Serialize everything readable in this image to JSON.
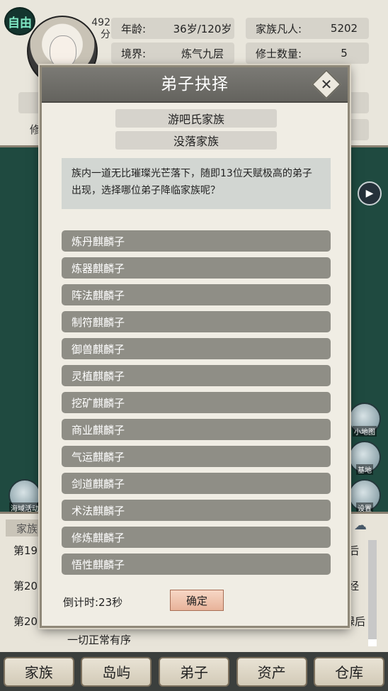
{
  "hud": {
    "free_badge": "自由",
    "score": "492分",
    "stats": [
      {
        "key": "年龄:",
        "value": "36岁/120岁"
      },
      {
        "key": "家族凡人:",
        "value": "5202"
      },
      {
        "key": "境界:",
        "value": "炼气九层"
      },
      {
        "key": "修士数量:",
        "value": "5"
      }
    ],
    "hidden_row_label": "修"
  },
  "side_buttons": {
    "minimap": "小地图",
    "base": "基地",
    "settings": "设置",
    "sea_event": "海域活动"
  },
  "chat": {
    "tab": "家族",
    "lines": [
      {
        "left": "第19",
        "right": "后"
      },
      {
        "left": "第20",
        "right": "经"
      },
      {
        "left": "第20",
        "right": "禄后"
      },
      {
        "left": "",
        "right": "一切正常有序"
      }
    ]
  },
  "modal": {
    "title": "弟子抉择",
    "families": [
      "游吧氏家族",
      "没落家族"
    ],
    "description": "族内一道无比璀璨光芒落下，随即13位天赋极高的弟子出现，选择哪位弟子降临家族呢？",
    "options": [
      "炼丹麒麟子",
      "炼器麒麟子",
      "阵法麒麟子",
      "制符麒麟子",
      "御兽麒麟子",
      "灵植麒麟子",
      "挖矿麒麟子",
      "商业麒麟子",
      "气运麒麟子",
      "剑道麒麟子",
      "术法麒麟子",
      "修炼麒麟子",
      "悟性麒麟子"
    ],
    "countdown": "倒计时:23秒",
    "confirm": "确定"
  },
  "bottom_nav": [
    "家族",
    "岛屿",
    "弟子",
    "资产",
    "仓库"
  ]
}
